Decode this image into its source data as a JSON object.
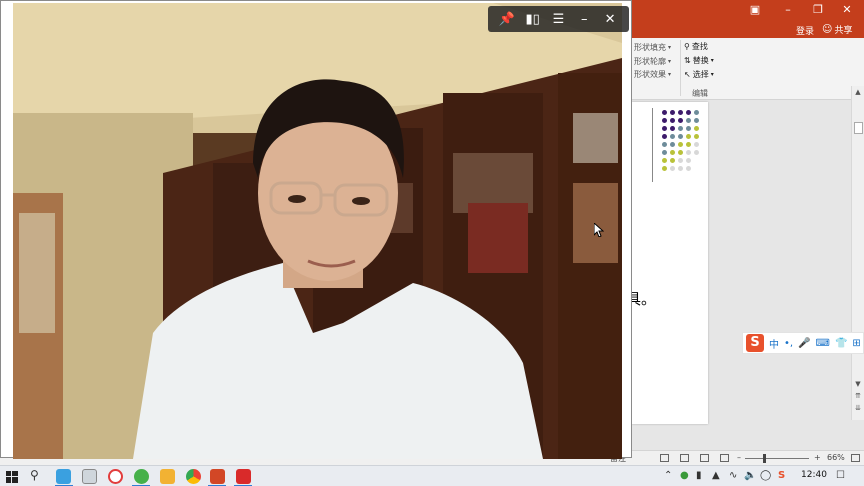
{
  "powerpoint": {
    "header": {
      "login_label": "登录",
      "share_label": "共享",
      "window_buttons": [
        "ribbon-display-icon",
        "minimize-icon",
        "restore-icon",
        "close-icon"
      ]
    },
    "ribbon": {
      "shape_fill": "形状填充",
      "shape_outline": "形状轮廓",
      "shape_effects": "形状效果",
      "find": "查找",
      "replace": "替换",
      "select": "选择",
      "group_editing": "编辑"
    },
    "slide": {
      "visible_text": "具。"
    },
    "status": {
      "notes_label": "备注",
      "zoom_level": "66%",
      "zoom_fraction": 0.28
    }
  },
  "camera_window": {
    "toolbar": [
      "pin-icon",
      "split-view-icon",
      "menu-icon",
      "minimize-icon",
      "close-icon"
    ]
  },
  "ime": {
    "logo": "S",
    "mode": "中",
    "punct": "•,"
  },
  "taskbar": {
    "apps": [
      "windows-start-icon",
      "search-icon",
      "ie-icon",
      "network-app-icon",
      "video-app-icon",
      "sogou-browser-icon",
      "photos-app-icon",
      "chrome-icon",
      "powerpoint-icon",
      "media-app-icon"
    ],
    "clock": "12:40"
  },
  "colors": {
    "ppt_accent": "#c43e1c",
    "taskbar_bg": "#e9ecf1"
  }
}
